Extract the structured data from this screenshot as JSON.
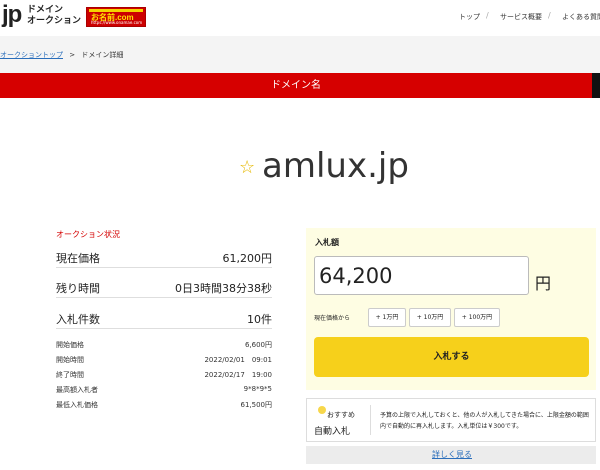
{
  "header": {
    "logo_jp": "jp",
    "logo_line1": "ドメイン",
    "logo_line2": "オークション",
    "partner_brand": "お名前.com",
    "partner_url": "https://www.onamae.com",
    "nav": [
      "トップ",
      "サービス概要",
      "よくある質問"
    ],
    "nav_sep": "/"
  },
  "breadcrumb": {
    "root": "オークショントップ",
    "sep": ">",
    "current": "ドメイン詳細"
  },
  "section_title": "ドメイン名",
  "domain": {
    "star": "☆",
    "name": "amlux.jp"
  },
  "auction": {
    "heading": "オークション状況",
    "rows": [
      {
        "label": "現在価格",
        "value": "61,200円"
      },
      {
        "label": "残り時間",
        "value": "0日3時間38分38秒"
      },
      {
        "label": "入札件数",
        "value": "10件"
      }
    ],
    "details": [
      {
        "label": "開始価格",
        "value": "6,600円"
      },
      {
        "label": "開始時間",
        "value": "2022/02/01　09:01"
      },
      {
        "label": "終了時間",
        "value": "2022/02/17　19:00"
      },
      {
        "label": "最高額入札者",
        "value": "9*8*9*5"
      },
      {
        "label": "最低入札価格",
        "value": "61,500円"
      }
    ]
  },
  "bid": {
    "label": "入札額",
    "value": "64,200",
    "yen": "円",
    "from_label": "現在価格から",
    "increments": [
      "+ 1万円",
      "+ 10万円",
      "+ 100万円"
    ],
    "submit": "入札する"
  },
  "recommend": {
    "small": "おすすめ",
    "title": "自動入札",
    "description": "予算の上限で入札しておくと、他の人が入札してきた場合に、上限金額の範囲内で自動的に再入札します。入札単位は￥300です。",
    "more_link": "詳しく見る"
  },
  "colors": {
    "red": "#d60000",
    "yellow": "#f6d01b",
    "link": "#2a6ebb"
  }
}
